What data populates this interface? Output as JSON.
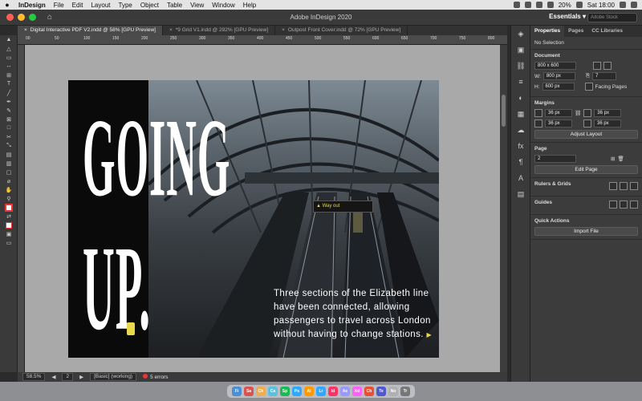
{
  "menubar": {
    "apple": "",
    "items": [
      "InDesign",
      "File",
      "Edit",
      "Layout",
      "Type",
      "Object",
      "Table",
      "View",
      "Window",
      "Help"
    ],
    "battery": "20%",
    "clock": "Sat 18:00"
  },
  "titlebar": {
    "title": "Adobe InDesign 2020",
    "workspace": "Essentials ▾",
    "search_placeholder": "Adobe Stock"
  },
  "doc_tabs": [
    "Digital Interactive PDF V2.indd @ 58% [GPU Preview]",
    "*9 Grid V1.indd @ 292% [GPU Preview]",
    "Outpost Front Cover.indd @ 72% [GPU Preview]"
  ],
  "ruler_marks": [
    "00",
    "50",
    "100",
    "150",
    "200",
    "250",
    "300",
    "350",
    "400",
    "450",
    "500",
    "550",
    "600",
    "650",
    "700",
    "750",
    "800"
  ],
  "page": {
    "headline_line1": "GOING",
    "headline_line2": "UP.",
    "sign_text": "▲ Way out",
    "caption_lines": [
      "Three sections of the Elizabeth line",
      "have been connected, allowing",
      "passengers to travel across London",
      "without having to change stations."
    ],
    "caption_arrow": "▶",
    "accent_color": "#e8d94a"
  },
  "statusbar": {
    "zoom": "58.5%",
    "page": "2",
    "style": "[Basic] (working)",
    "errors": "5 errors"
  },
  "panel": {
    "tabs": [
      "Properties",
      "Pages",
      "CC Libraries"
    ],
    "selection": "No Selection",
    "document_label": "Document",
    "doc_preset": "800 x 600",
    "width_label": "W:",
    "width_value": "800 px",
    "height_label": "H:",
    "height_value": "600 px",
    "pages_count": "7",
    "facing_pages": "Facing Pages",
    "margins_label": "Margins",
    "margin_top": "36 px",
    "margin_bottom": "36 px",
    "margin_left": "36 px",
    "margin_right": "36 px",
    "adjust_layout": "Adjust Layout",
    "page_label": "Page",
    "page_value": "2",
    "edit_page": "Edit Page",
    "rulers_grids": "Rulers & Grids",
    "guides": "Guides",
    "quick_actions": "Quick Actions",
    "import_file": "Import File"
  },
  "dock_apps": [
    "Fi",
    "Sa",
    "Ch",
    "Ca",
    "Sp",
    "Ps",
    "Ai",
    "Lr",
    "Id",
    "Ae",
    "Xd",
    "Ch",
    "Te",
    "No",
    "Tr"
  ]
}
